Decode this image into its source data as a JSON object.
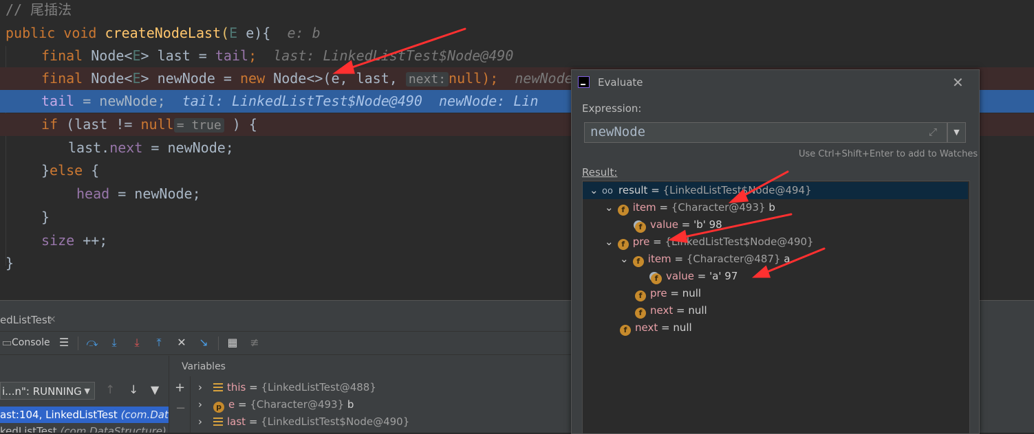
{
  "editor": {
    "comment": "// 尾插法",
    "line1": {
      "kw1": "public",
      "kw2": "void",
      "fn": "createNodeLast",
      "p1": "(",
      "gen": "E",
      "p2": " e){",
      "hint": "e: b"
    },
    "line2": {
      "kw": "final",
      "t1": " Node<",
      "gen": "E",
      "t2": "> last = ",
      "fld": "tail",
      "t3": ";",
      "hint": "last: LinkedListTest$Node@490"
    },
    "line3": {
      "kw": "final",
      "t1": " Node<",
      "gen": "E",
      "t2": "> newNode = ",
      "kw2": "new",
      "t3": " Node<>(e, last, ",
      "inlay": "next:",
      "kw3": "null",
      "t4": ");",
      "hint": "newNode: LinkedList"
    },
    "line4": {
      "fld": "tail",
      "t1": " = newNode;",
      "hint": "tail: LinkedListTest$Node@490  newNode: Lin"
    },
    "line5": {
      "kw": "if",
      "t1": " (last != ",
      "kw2": "null",
      "inlay": "= true",
      "t2": " ) {"
    },
    "line6": {
      "t1": "last.",
      "fld": "next",
      "t2": " = newNode;"
    },
    "line7": {
      "t1": "}",
      "kw": "else",
      "t2": " {"
    },
    "line8": {
      "fld": "head",
      "t1": " = newNode;"
    },
    "line9": {
      "t1": "}"
    },
    "line10": {
      "fld": "size",
      "t1": " ++;"
    },
    "line11": {
      "t1": "}"
    }
  },
  "debugger": {
    "tab_label": "edListTest",
    "tab_close": "×",
    "console_label": "Console",
    "thread_select": "i...n\": RUNNING",
    "frames": [
      {
        "text": "ast:104, LinkedListTest ",
        "pkg": "(com.Data..."
      },
      {
        "text": "kedListTest ",
        "pkg": "(com.DataStructure)"
      }
    ],
    "variables_header": "Variables",
    "variables": [
      {
        "name": "this",
        "eq": " = ",
        "val": "{LinkedListTest@488}",
        "tail": ""
      },
      {
        "name": "e",
        "eq": " = ",
        "val": "{Character@493}",
        "tail": " b"
      },
      {
        "name": "last",
        "eq": " = ",
        "val": "{LinkedListTest$Node@490}",
        "tail": ""
      }
    ]
  },
  "evaluate": {
    "title": "Evaluate",
    "expression_label": "Expression:",
    "expression_value": "newNode",
    "watch_hint": "Use Ctrl+Shift+Enter to add to Watches",
    "result_label": "Result:",
    "tree": [
      {
        "name": "result",
        "eq": " = ",
        "val": "{LinkedListTest$Node@494}",
        "tail": ""
      },
      {
        "name": "item",
        "eq": " = ",
        "val": "{Character@493}",
        "tail": " b"
      },
      {
        "name": "value",
        "eq": " = ",
        "val": "",
        "tail": "'b' 98"
      },
      {
        "name": "pre",
        "eq": " = ",
        "val": "{LinkedListTest$Node@490}",
        "tail": ""
      },
      {
        "name": "item",
        "eq": " = ",
        "val": "{Character@487}",
        "tail": " a"
      },
      {
        "name": "value",
        "eq": " = ",
        "val": "",
        "tail": "'a' 97"
      },
      {
        "name": "pre",
        "eq": " = ",
        "val": "",
        "tail": "null"
      },
      {
        "name": "next",
        "eq": " = ",
        "val": "",
        "tail": "null"
      },
      {
        "name": "next",
        "eq": " = ",
        "val": "",
        "tail": "null"
      }
    ]
  },
  "colors": {
    "accent": "#2f65ca",
    "annotation_arrow": "#ff3030",
    "field_icon": "#c68a2c"
  }
}
